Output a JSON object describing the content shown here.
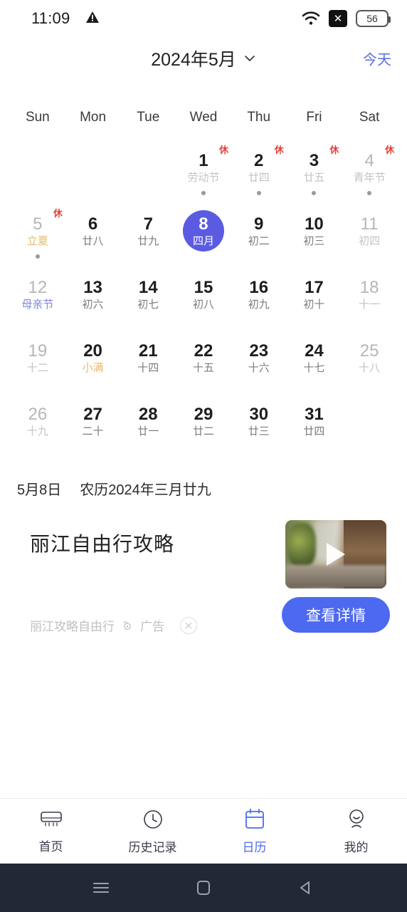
{
  "status_bar": {
    "time": "11:09",
    "warning_icon": "warning-triangle-icon",
    "wifi_icon": "wifi-icon",
    "no_sim_icon": "no-sim-x-icon",
    "battery_level": "56"
  },
  "header": {
    "month_title": "2024年5月",
    "dropdown_icon": "chevron-down-icon",
    "today_label": "今天"
  },
  "calendar": {
    "weekday_labels": [
      "Sun",
      "Mon",
      "Tue",
      "Wed",
      "Thu",
      "Fri",
      "Sat"
    ],
    "selected_day": 8,
    "accent_color": "#5b5be2",
    "rest_badge_color": "#e8403a",
    "solar_term_color": "#e8b96a",
    "festival_color": "#7f86d6",
    "weeks": [
      [
        {
          "day": "",
          "lunar": ""
        },
        {
          "day": "",
          "lunar": ""
        },
        {
          "day": "",
          "lunar": ""
        },
        {
          "day": "1",
          "lunar": "劳动节",
          "rest": "休",
          "dot": true,
          "lunar_style": "dim"
        },
        {
          "day": "2",
          "lunar": "廿四",
          "rest": "休",
          "dot": true,
          "lunar_style": "dim"
        },
        {
          "day": "3",
          "lunar": "廿五",
          "rest": "休",
          "dot": true,
          "lunar_style": "dim"
        },
        {
          "day": "4",
          "lunar": "青年节",
          "rest": "休",
          "dot": true,
          "day_style": "dim",
          "lunar_style": "dim"
        }
      ],
      [
        {
          "day": "5",
          "lunar": "立夏",
          "rest": "休",
          "dot": true,
          "day_style": "dim",
          "lunar_style": "term"
        },
        {
          "day": "6",
          "lunar": "廿八"
        },
        {
          "day": "7",
          "lunar": "廿九"
        },
        {
          "day": "8",
          "lunar": "四月",
          "selected": true
        },
        {
          "day": "9",
          "lunar": "初二"
        },
        {
          "day": "10",
          "lunar": "初三"
        },
        {
          "day": "11",
          "lunar": "初四",
          "day_style": "dim",
          "lunar_style": "dim"
        }
      ],
      [
        {
          "day": "12",
          "lunar": "母亲节",
          "day_style": "dim",
          "lunar_style": "fest"
        },
        {
          "day": "13",
          "lunar": "初六"
        },
        {
          "day": "14",
          "lunar": "初七"
        },
        {
          "day": "15",
          "lunar": "初八"
        },
        {
          "day": "16",
          "lunar": "初九"
        },
        {
          "day": "17",
          "lunar": "初十"
        },
        {
          "day": "18",
          "lunar": "十一",
          "day_style": "dim",
          "lunar_style": "dim"
        }
      ],
      [
        {
          "day": "19",
          "lunar": "十二",
          "day_style": "dim",
          "lunar_style": "dim"
        },
        {
          "day": "20",
          "lunar": "小满",
          "lunar_style": "term"
        },
        {
          "day": "21",
          "lunar": "十四"
        },
        {
          "day": "22",
          "lunar": "十五"
        },
        {
          "day": "23",
          "lunar": "十六"
        },
        {
          "day": "24",
          "lunar": "十七"
        },
        {
          "day": "25",
          "lunar": "十八",
          "day_style": "dim",
          "lunar_style": "dim"
        }
      ],
      [
        {
          "day": "26",
          "lunar": "十九",
          "day_style": "dim",
          "lunar_style": "dim"
        },
        {
          "day": "27",
          "lunar": "二十"
        },
        {
          "day": "28",
          "lunar": "廿一"
        },
        {
          "day": "29",
          "lunar": "廿二"
        },
        {
          "day": "30",
          "lunar": "廿三"
        },
        {
          "day": "31",
          "lunar": "廿四"
        },
        {
          "day": "",
          "lunar": ""
        }
      ]
    ]
  },
  "date_info": {
    "gregorian": "5月8日",
    "lunar": "农历2024年三月廿九"
  },
  "ad": {
    "title": "丽江自由行攻略",
    "source": "丽江攻略自由行",
    "tag_icon": "ad-target-icon",
    "tag_label": "广告",
    "close_icon": "close-circle-icon",
    "play_icon": "play-triangle-icon",
    "cta_label": "查看详情",
    "cta_color": "#4d69f0"
  },
  "tabbar": {
    "items": [
      {
        "label": "首页",
        "icon": "air-conditioner-icon",
        "active": false
      },
      {
        "label": "历史记录",
        "icon": "clock-icon",
        "active": false
      },
      {
        "label": "日历",
        "icon": "calendar-icon",
        "active": true
      },
      {
        "label": "我的",
        "icon": "person-icon",
        "active": false
      }
    ],
    "active_color": "#4d69f0"
  },
  "system_nav": {
    "recents_icon": "menu-lines-icon",
    "home_icon": "home-square-icon",
    "back_icon": "back-triangle-icon"
  }
}
